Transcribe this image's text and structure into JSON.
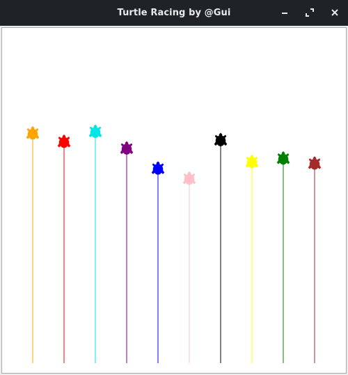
{
  "window": {
    "title": "Turtle Racing by @Gui",
    "buttons": {
      "minimize": "minimize-icon",
      "maximize": "maximize-icon",
      "close": "close-icon"
    }
  },
  "race": {
    "background": "#ffffff",
    "turtles": [
      {
        "color": "#ffa500",
        "progress": 0.685
      },
      {
        "color": "#ff0000",
        "progress": 0.66
      },
      {
        "color": "#00e5e5",
        "progress": 0.69
      },
      {
        "color": "#800080",
        "progress": 0.64
      },
      {
        "color": "#0000ff",
        "progress": 0.58
      },
      {
        "color": "#ffc0cb",
        "progress": 0.55
      },
      {
        "color": "#000000",
        "progress": 0.665
      },
      {
        "color": "#ffff00",
        "progress": 0.6
      },
      {
        "color": "#008000",
        "progress": 0.61
      },
      {
        "color": "#a52a2a",
        "progress": 0.595
      }
    ]
  }
}
